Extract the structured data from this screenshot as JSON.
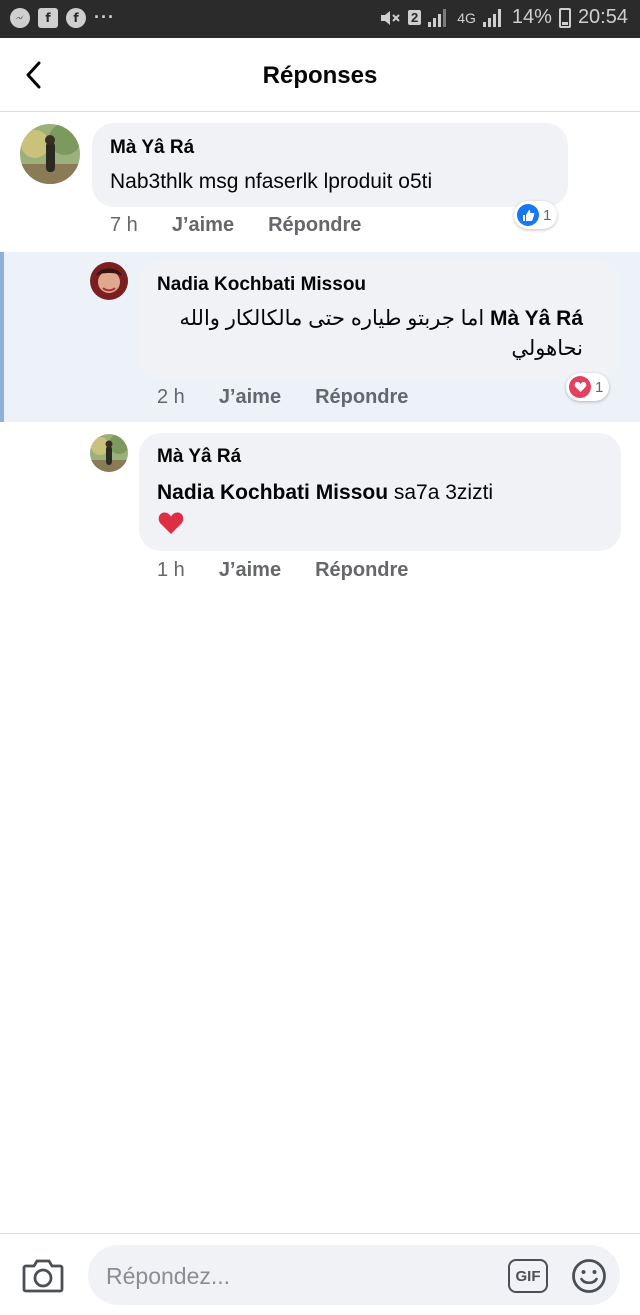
{
  "status_bar": {
    "left_icons": [
      "messenger-icon",
      "facebook-icon",
      "facebook-circle-icon"
    ],
    "more_dots": "···",
    "sim_badge": "2",
    "network": "4G",
    "battery_percent": "14%",
    "time": "20:54"
  },
  "header": {
    "title": "Réponses",
    "back_icon": "chevron-left-icon"
  },
  "comments": [
    {
      "author": "Mà Yâ Rá",
      "text": "Nab3thlk msg nfaserlk lproduit o5ti",
      "time": "7 h",
      "like_label": "J’aime",
      "reply_label": "Répondre",
      "reaction": {
        "icon": "like-icon",
        "count": "1",
        "color": "#1877f2"
      }
    },
    {
      "author": "Nadia Kochbati Missou",
      "mention": "Mà Yâ Rá",
      "text": "اما جربتو طياره حتى مالكالكار والله نحاهولي",
      "time": "2 h",
      "like_label": "J’aime",
      "reply_label": "Répondre",
      "reaction": {
        "icon": "love-icon",
        "count": "1",
        "color": "#e4405f"
      }
    },
    {
      "author": "Mà Yâ Rá",
      "mention": "Nadia Kochbati Missou",
      "text": "sa7a 3zizti",
      "emoji": "heart-emoji",
      "time": "1 h",
      "like_label": "J’aime",
      "reply_label": "Répondre"
    }
  ],
  "composer": {
    "placeholder": "Répondez...",
    "gif_label": "GIF",
    "camera_icon": "camera-icon",
    "emoji_icon": "smiley-icon"
  },
  "colors": {
    "bubble": "#f0f2f5",
    "highlight": "#edf1f8",
    "highlight_bar": "#8fb0d8",
    "secondary_text": "#65676b",
    "status_bar": "#2b2b2b"
  }
}
